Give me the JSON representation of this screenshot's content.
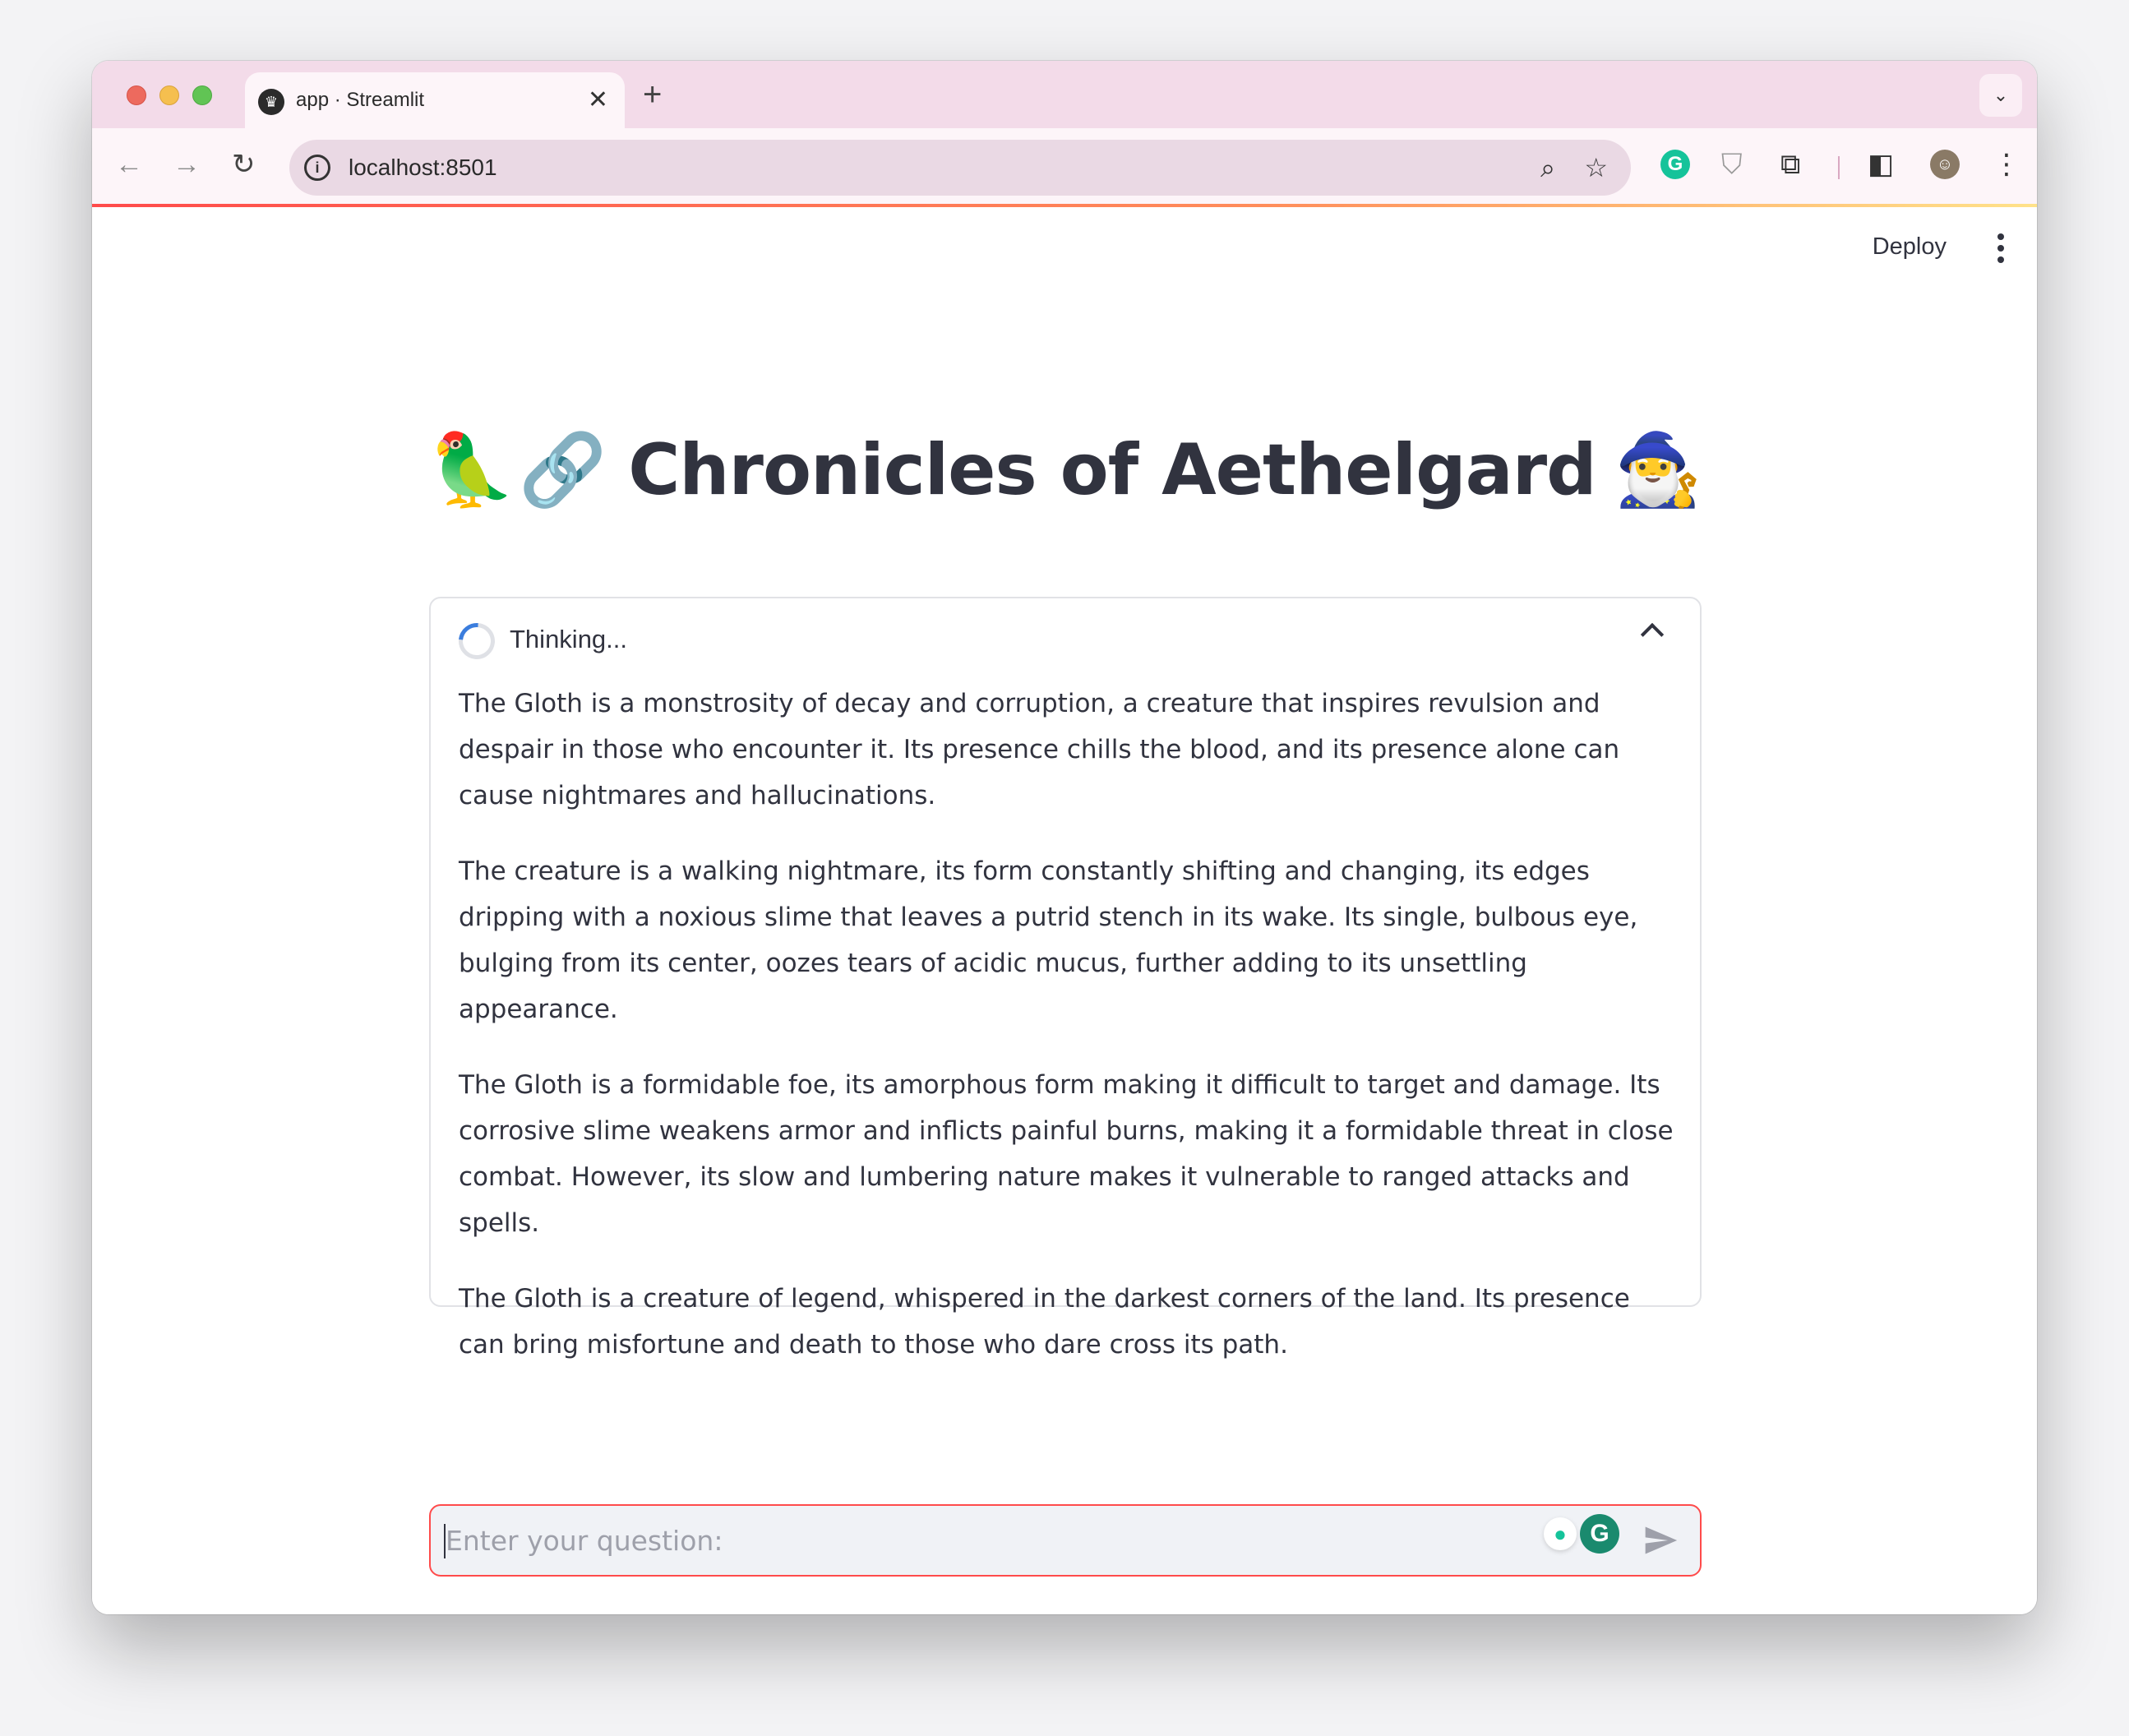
{
  "browser": {
    "tab_title": "app · Streamlit",
    "tab_close_glyph": "✕",
    "new_tab_glyph": "+",
    "tab_menu_glyph": "⌄",
    "url": "localhost:8501",
    "nav": {
      "back": "←",
      "forward": "→",
      "reload": "↻"
    },
    "icons": {
      "info": "i",
      "zoom": "⌕",
      "star": "☆",
      "grammarly": "G",
      "shield": "⛉",
      "puzzle": "⧉",
      "side_panel": "◧",
      "avatar": "☺",
      "menu": "⋮",
      "favicon": "♛"
    }
  },
  "app": {
    "header": {
      "deploy_label": "Deploy"
    },
    "title": {
      "emoji_left_1": "🦜",
      "emoji_left_2": "🔗",
      "text": "Chronicles of Aethelgard",
      "emoji_right": "🧙‍♂️"
    },
    "status": {
      "label": "Thinking...",
      "expanded": true,
      "paragraphs": [
        "The Gloth is a monstrosity of decay and corruption, a creature that inspires revulsion and despair in those who encounter it. Its presence chills the blood, and its presence alone can cause nightmares and hallucinations.",
        "The creature is a walking nightmare, its form constantly shifting and changing, its edges dripping with a noxious slime that leaves a putrid stench in its wake. Its single, bulbous eye, bulging from its center, oozes tears of acidic mucus, further adding to its unsettling appearance.",
        "The Gloth is a formidable foe, its amorphous form making it difficult to target and damage. Its corrosive slime weakens armor and inflicts painful burns, making it a formidable threat in close combat. However, its slow and lumbering nature makes it vulnerable to ranged attacks and spells.",
        "The Gloth is a creature of legend, whispered in the darkest corners of the land. Its presence can bring misfortune and death to those who dare cross its path."
      ]
    },
    "chat": {
      "placeholder": "Enter your question:",
      "value": ""
    }
  },
  "colors": {
    "accent": "#ff4b4b",
    "text": "#31333f",
    "spinner": "#3b7ddd",
    "tabstrip": "#f3dbe9"
  }
}
